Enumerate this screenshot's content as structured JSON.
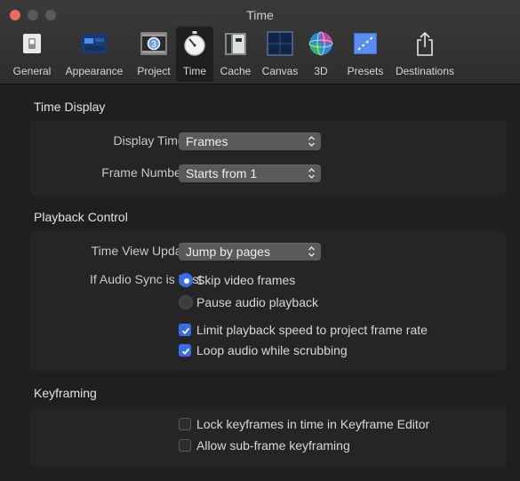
{
  "window": {
    "title": "Time"
  },
  "toolbar": {
    "items": [
      {
        "label": "General",
        "icon": "general-switch-icon"
      },
      {
        "label": "Appearance",
        "icon": "appearance-icon"
      },
      {
        "label": "Project",
        "icon": "project-icon"
      },
      {
        "label": "Time",
        "icon": "stopwatch-icon",
        "selected": true
      },
      {
        "label": "Cache",
        "icon": "cache-icon"
      },
      {
        "label": "Canvas",
        "icon": "canvas-icon"
      },
      {
        "label": "3D",
        "icon": "3d-sphere-icon"
      },
      {
        "label": "Presets",
        "icon": "presets-icon"
      },
      {
        "label": "Destinations",
        "icon": "share-icon"
      }
    ]
  },
  "time_display": {
    "title": "Time Display",
    "display_time_as_label": "Display Time As:",
    "display_time_as_value": "Frames",
    "frame_numbering_label": "Frame Numbering:",
    "frame_numbering_value": "Starts from 1"
  },
  "playback_control": {
    "title": "Playback Control",
    "time_view_updating_label": "Time View Updating:",
    "time_view_updating_value": "Jump by pages",
    "audio_sync_label": "If Audio Sync is Lost:",
    "radio_skip": "Skip video frames",
    "radio_skip_selected": true,
    "radio_pause": "Pause audio playback",
    "radio_pause_selected": false,
    "limit_speed_label": "Limit playback speed to project frame rate",
    "limit_speed_checked": true,
    "loop_audio_label": "Loop audio while scrubbing",
    "loop_audio_checked": true
  },
  "keyframing": {
    "title": "Keyframing",
    "lock_keyframes_label": "Lock keyframes in time in Keyframe Editor",
    "lock_keyframes_checked": false,
    "subframe_label": "Allow sub-frame keyframing",
    "subframe_checked": false
  },
  "colors": {
    "accent": "#3a6ee8",
    "close_button": "#ec6a5e"
  }
}
